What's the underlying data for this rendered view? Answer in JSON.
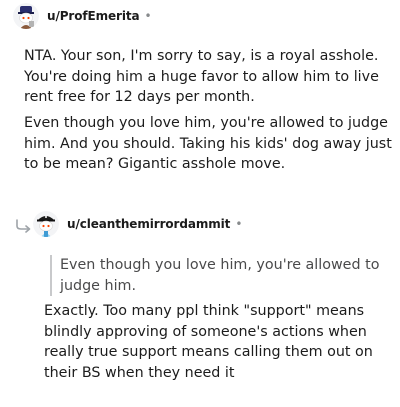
{
  "comment1": {
    "username": "u/ProfEmerita",
    "separator": "•",
    "paragraphs": [
      "NTA. Your son, I'm sorry to say, is a royal asshole. You're doing him a huge favor to allow him to live rent free for 12 days per month.",
      "Even though you love him, you're allowed to judge him. And you should. Taking his kids' dog away just to be mean? Gigantic asshole move."
    ]
  },
  "comment2": {
    "username": "u/cleanthemirrordammit",
    "separator": "•",
    "quote": "Even though you love him, you're allowed to judge him.",
    "paragraphs": [
      "Exactly. Too many ppl think \"support\" means blindly approving of someone's actions when really true support means calling them out on their BS when they need it"
    ]
  },
  "icons": {
    "comment1_avatar": "snoo-avatar-icon",
    "comment2_avatar": "snoo-avatar-icon",
    "reply_indicator": "reply-arrow-icon"
  },
  "colors": {
    "text": "#1c1c1c",
    "meta": "#878a8c",
    "quote_bar": "#c8c9cb",
    "quote_text": "#4a4a4b"
  }
}
